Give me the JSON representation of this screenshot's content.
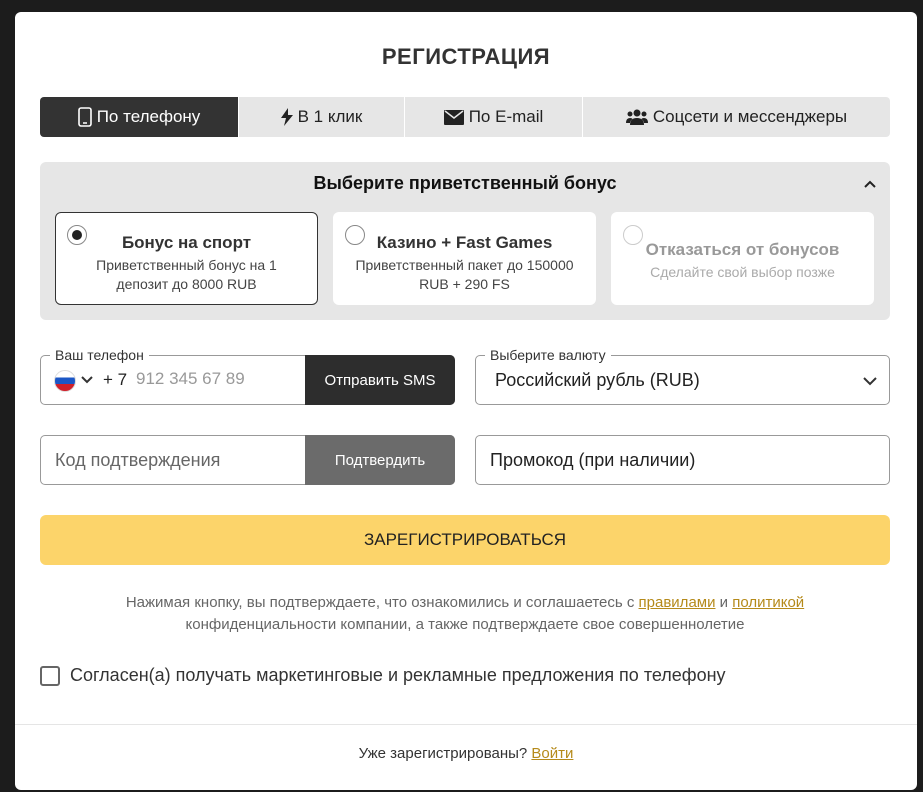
{
  "title": "РЕГИСТРАЦИЯ",
  "tabs": [
    {
      "label": "По телефону",
      "icon": "phone-icon"
    },
    {
      "label": "В 1 клик",
      "icon": "lightning-icon"
    },
    {
      "label": "По E-mail",
      "icon": "envelope-icon"
    },
    {
      "label": "Соцсети и мессенджеры",
      "icon": "users-icon"
    }
  ],
  "bonus": {
    "title": "Выберите приветственный бонус",
    "options": [
      {
        "title": "Бонус на спорт",
        "desc": "Приветственный бонус на 1 депозит до 8000 RUB",
        "selected": true
      },
      {
        "title": "Казино + Fast Games",
        "desc": "Приветственный пакет до 150000 RUB + 290 FS",
        "selected": false
      },
      {
        "title": "Отказаться от бонусов",
        "desc": "Сделайте свой выбор позже",
        "selected": false
      }
    ]
  },
  "phone": {
    "legend": "Ваш телефон",
    "prefix": "+ 7",
    "placeholder": "912 345 67 89",
    "country_flag": "russia-flag-icon",
    "send_sms": "Отправить SMS"
  },
  "currency": {
    "legend": "Выберите валюту",
    "value": "Российский рубль (RUB)"
  },
  "code": {
    "placeholder": "Код подтверждения",
    "confirm": "Подтвердить"
  },
  "promo": {
    "placeholder": "Промокод (при наличии)"
  },
  "register_button": "ЗАРЕГИСТРИРОВАТЬСЯ",
  "terms": {
    "part1": "Нажимая кнопку, вы подтверждаете, что ознакомились и соглашаетесь с ",
    "rules_link": "правилами",
    "and": " и ",
    "policy_link": "политикой",
    "part2": " конфиденциальности компании, а также подтверждаете свое совершеннолетие"
  },
  "consent_label": "Согласен(а) получать маркетинговые и рекламные предложения по телефону",
  "footer": {
    "text": "Уже зарегистрированы? ",
    "login_link": "Войти"
  },
  "colors": {
    "accent": "#fcd46a",
    "link": "#b58a1a",
    "dark": "#2d2d2d"
  }
}
